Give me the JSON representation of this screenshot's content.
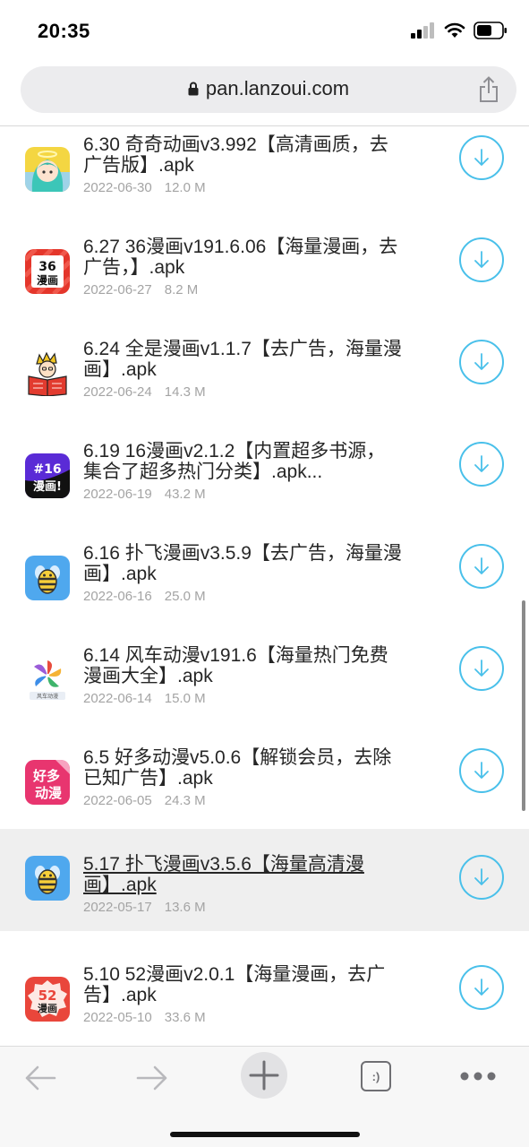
{
  "status_bar": {
    "time": "20:35"
  },
  "url_bar": {
    "domain": "pan.lanzoui.com"
  },
  "files": [
    {
      "name": "6.30 奇奇动画v3.992【高清画质，去广告版】.apk",
      "date": "2022-06-30",
      "size": "12.0 M",
      "icon": "qiqi-anime-app-icon"
    },
    {
      "name": "6.27 36漫画v191.6.06【海量漫画，去广告，】.apk",
      "date": "2022-06-27",
      "size": "8.2 M",
      "icon": "36-manhua-app-icon"
    },
    {
      "name": "6.24 全是漫画v1.1.7【去广告，海量漫画】.apk",
      "date": "2022-06-24",
      "size": "14.3 M",
      "icon": "quanshi-manhua-app-icon"
    },
    {
      "name": "6.19 16漫画v2.1.2【内置超多书源， 集合了超多热门分类】.apk...",
      "date": "2022-06-19",
      "size": "43.2 M",
      "icon": "16-manhua-app-icon"
    },
    {
      "name": "6.16 扑飞漫画v3.5.9【去广告，海量漫画】.apk",
      "date": "2022-06-16",
      "size": "25.0 M",
      "icon": "pufei-bee-app-icon"
    },
    {
      "name": "6.14 风车动漫v191.6【海量热门免费漫画大全】.apk",
      "date": "2022-06-14",
      "size": "15.0 M",
      "icon": "fengche-pinwheel-app-icon"
    },
    {
      "name": "6.5 好多动漫v5.0.6【解锁会员，去除已知广告】.apk",
      "date": "2022-06-05",
      "size": "24.3 M",
      "icon": "haoduo-dongman-app-icon"
    },
    {
      "name": "5.17 扑飞漫画v3.5.6【海量高清漫画】.apk",
      "date": "2022-05-17",
      "size": "13.6 M",
      "icon": "pufei-bee-app-icon"
    },
    {
      "name": "5.10 52漫画v2.0.1【海量漫画，去广告】.apk",
      "date": "2022-05-10",
      "size": "33.6 M",
      "icon": "52-manhua-app-icon"
    }
  ],
  "icon_text": {
    "n36_top": "36",
    "n36_bottom": "漫画",
    "n16_top": "#16",
    "n16_bottom": "漫画!",
    "haoduo_top": "好多",
    "haoduo_bottom": "动漫",
    "fengche_label": "风车动漫",
    "n52_top": "52",
    "n52_bottom": "漫画"
  },
  "toolbar": {
    "tab_label": ":)"
  },
  "colors": {
    "accent": "#49c0ea",
    "highlight_row": "#efefef",
    "meta_text": "#a4a4a4"
  }
}
